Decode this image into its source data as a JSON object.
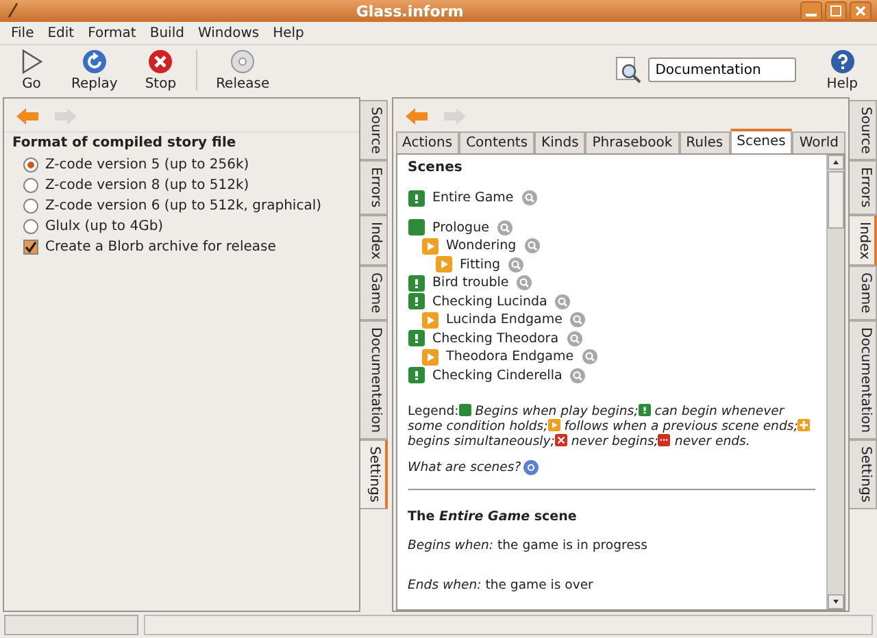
{
  "window": {
    "title": "Glass.inform"
  },
  "menu": [
    "File",
    "Edit",
    "Format",
    "Build",
    "Windows",
    "Help"
  ],
  "toolbar": [
    {
      "label": "Go",
      "kind": "go"
    },
    {
      "label": "Replay",
      "kind": "replay"
    },
    {
      "label": "Stop",
      "kind": "stop"
    },
    {
      "label": "Release",
      "kind": "release"
    }
  ],
  "search": {
    "value": "Documentation"
  },
  "help": {
    "label": "Help"
  },
  "left_panel": {
    "heading": "Format of compiled story file",
    "options": [
      {
        "kind": "radio",
        "label": "Z-code version 5 (up to 256k)",
        "selected": true
      },
      {
        "kind": "radio",
        "label": "Z-code version 8 (up to 512k)",
        "selected": false
      },
      {
        "kind": "radio",
        "label": "Z-code version 6 (up to 512k, graphical)",
        "selected": false
      },
      {
        "kind": "radio",
        "label": "Glulx (up to 4Gb)",
        "selected": false
      },
      {
        "kind": "checkbox",
        "label": "Create a Blorb archive for release",
        "selected": true
      }
    ],
    "side_tabs": [
      {
        "label": "Source",
        "selected": false
      },
      {
        "label": "Errors",
        "selected": false
      },
      {
        "label": "Index",
        "selected": false
      },
      {
        "label": "Game",
        "selected": false
      },
      {
        "label": "Documentation",
        "selected": false
      },
      {
        "label": "Settings",
        "selected": true
      }
    ]
  },
  "right_panel": {
    "tabs": [
      {
        "label": "Actions",
        "selected": false
      },
      {
        "label": "Contents",
        "selected": false
      },
      {
        "label": "Kinds",
        "selected": false
      },
      {
        "label": "Phrasebook",
        "selected": false
      },
      {
        "label": "Rules",
        "selected": false
      },
      {
        "label": "Scenes",
        "selected": true
      },
      {
        "label": "World",
        "selected": false
      }
    ],
    "heading": "Scenes",
    "scenes": [
      {
        "name": "Entire Game",
        "kind": "whenever"
      },
      {
        "name": "Prologue",
        "kind": "play",
        "children": [
          {
            "name": "Wondering",
            "kind": "follows",
            "children": [
              {
                "name": "Fitting",
                "kind": "follows"
              }
            ]
          }
        ]
      },
      {
        "name": "Bird trouble",
        "kind": "whenever"
      },
      {
        "name": "Checking Lucinda",
        "kind": "whenever",
        "children": [
          {
            "name": "Lucinda Endgame",
            "kind": "follows"
          }
        ]
      },
      {
        "name": "Checking Theodora",
        "kind": "whenever",
        "children": [
          {
            "name": "Theodora Endgame",
            "kind": "follows"
          }
        ]
      },
      {
        "name": "Checking Cinderella",
        "kind": "whenever"
      }
    ],
    "legend": {
      "label": "Legend:",
      "items": [
        {
          "kind": "play",
          "text": "*Begins when play begins;*"
        },
        {
          "kind": "whenever",
          "text": "*can begin whenever some condition holds;*"
        },
        {
          "kind": "follows",
          "text": "*follows when a previous scene ends;*"
        },
        {
          "kind": "simultaneous",
          "text": "*begins simultaneously;*"
        },
        {
          "kind": "never_begins",
          "text": "*never begins;*"
        },
        {
          "kind": "never_ends",
          "text": "*never ends.*"
        }
      ]
    },
    "help_link": "What are scenes?",
    "section_title": "The *Entire Game* scene",
    "definitions": [
      "*Begins when:* the game is in progress",
      "*Ends when:* the game is over"
    ],
    "side_tabs": [
      {
        "label": "Source",
        "selected": false
      },
      {
        "label": "Errors",
        "selected": false
      },
      {
        "label": "Index",
        "selected": true
      },
      {
        "label": "Game",
        "selected": false
      },
      {
        "label": "Documentation",
        "selected": false
      },
      {
        "label": "Settings",
        "selected": false
      }
    ]
  }
}
